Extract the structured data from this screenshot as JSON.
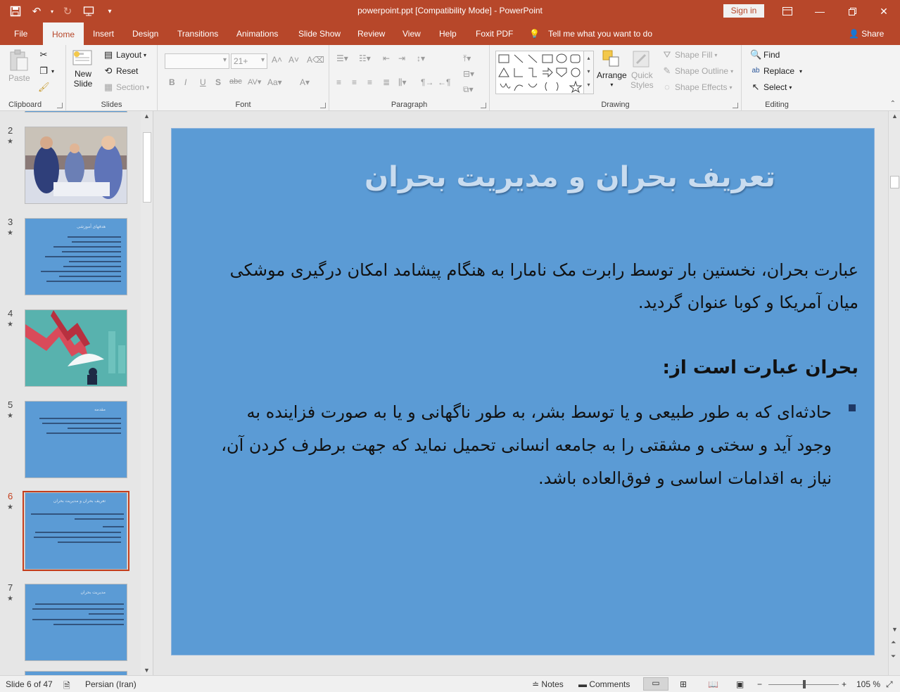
{
  "titlebar": {
    "doc_title": "powerpoint.ppt [Compatibility Mode]  -  PowerPoint",
    "signin": "Sign in"
  },
  "tabs": [
    "File",
    "Home",
    "Insert",
    "Design",
    "Transitions",
    "Animations",
    "Slide Show",
    "Review",
    "View",
    "Help",
    "Foxit PDF"
  ],
  "active_tab": "Home",
  "tellme": "Tell me what you want to do",
  "share": "Share",
  "ribbon": {
    "clipboard": {
      "label": "Clipboard",
      "paste": "Paste"
    },
    "slides": {
      "label": "Slides",
      "new_slide_1": "New",
      "new_slide_2": "Slide",
      "layout": "Layout",
      "reset": "Reset",
      "section": "Section"
    },
    "font": {
      "label": "Font",
      "size": "21+"
    },
    "paragraph": {
      "label": "Paragraph"
    },
    "drawing": {
      "label": "Drawing",
      "arrange": "Arrange",
      "quick_1": "Quick",
      "quick_2": "Styles",
      "shape_fill": "Shape Fill",
      "shape_outline": "Shape Outline",
      "shape_effects": "Shape Effects"
    },
    "editing": {
      "label": "Editing",
      "find": "Find",
      "replace": "Replace",
      "select": "Select"
    }
  },
  "thumbnails": [
    {
      "num": "2"
    },
    {
      "num": "3"
    },
    {
      "num": "4"
    },
    {
      "num": "5"
    },
    {
      "num": "6"
    },
    {
      "num": "7"
    }
  ],
  "thumb_texts": {
    "t3": "هدفهای آموزشی",
    "t5": "مقدمه",
    "t6": "تعریف بحران و مدیریت بحران",
    "t7": "مدیریت بحران"
  },
  "slide": {
    "title": "تعریف بحران و مدیریت بحران",
    "para1": "عبارت بحران، نخستین بار توسط رابرت مک نامارا به هنگام پیشامد امکان درگیری موشکی میان آمریکا و کوبا عنوان گردید.",
    "para2": "بحران عبارت است از:",
    "para3": "حادثه‌ای که به طور طبیعی و یا توسط بشر، به طور ناگهانی و یا به صورت فزاینده به وجود آید و سختی و مشقتی را به جامعه انسانی تحمیل نماید که جهت برطرف کردن آن، نیاز به اقدامات اساسی و فوق‌العاده باشد."
  },
  "status": {
    "slide_of": "Slide 6 of 47",
    "language": "Persian (Iran)",
    "notes": "Notes",
    "comments": "Comments",
    "zoom": "105 %",
    "zoom_level": 105
  },
  "colors": {
    "accent": "#b7472a",
    "slide_bg": "#5b9bd5",
    "selected": "#c43e1c"
  }
}
